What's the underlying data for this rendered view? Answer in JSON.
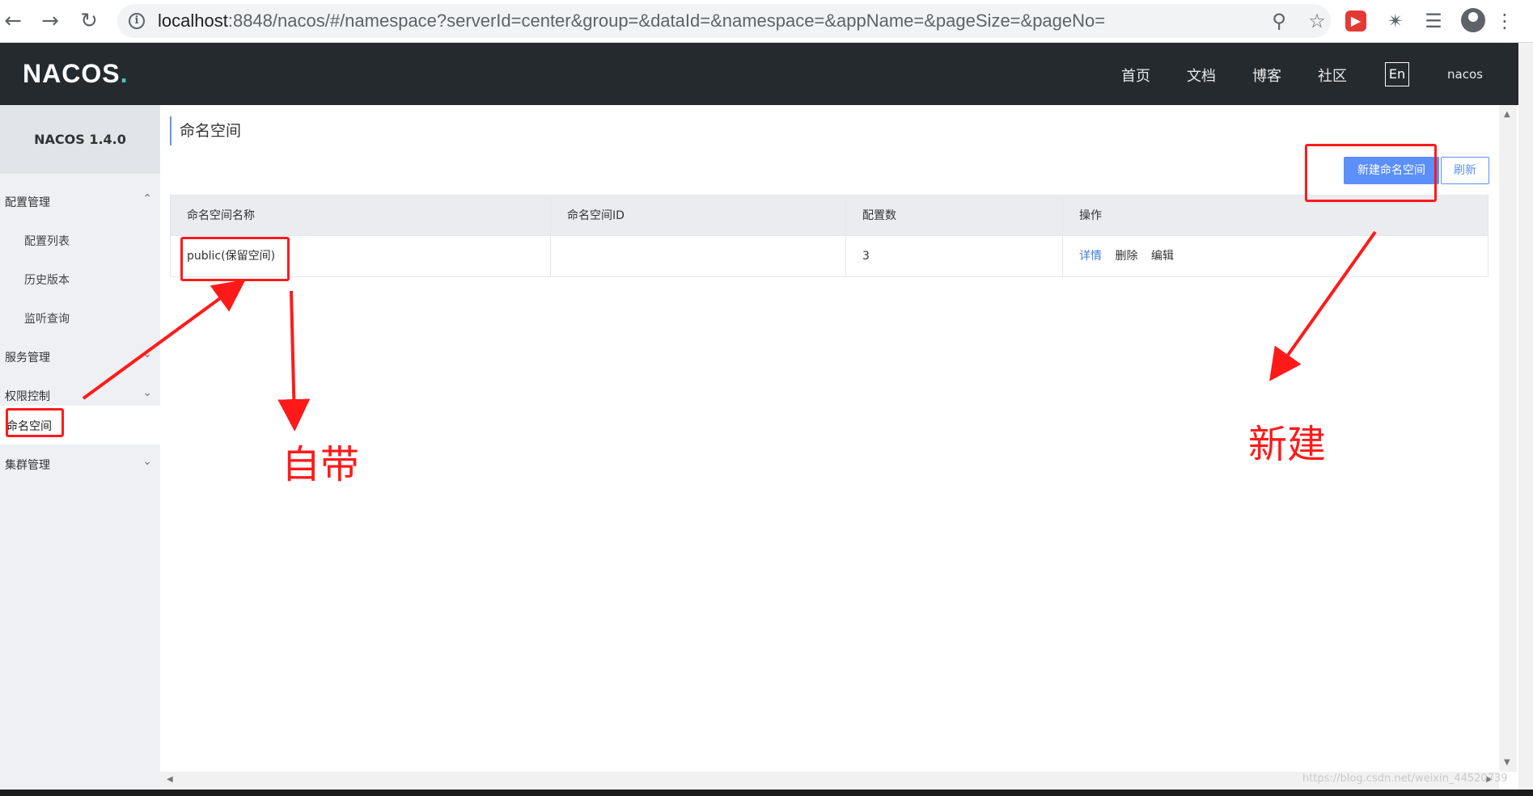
{
  "browser": {
    "url_host": "localhost",
    "url_rest": ":8848/nacos/#/namespace?serverId=center&group=&dataId=&namespace=&appName=&pageSize=&pageNo=",
    "icons": [
      "back-icon",
      "forward-icon",
      "reload-icon",
      "info-icon",
      "zoom-icon",
      "star-icon",
      "extension-red-icon",
      "puzzle-icon",
      "media-icon",
      "profile-icon",
      "menu-dots-icon"
    ]
  },
  "header": {
    "logo": "NACOS",
    "logo_dot": ".",
    "nav": [
      "首页",
      "文档",
      "博客",
      "社区"
    ],
    "lang": "En",
    "user": "nacos"
  },
  "sidebar": {
    "version": "NACOS 1.4.0",
    "groups": [
      {
        "label": "配置管理",
        "chevron": "^"
      },
      {
        "label": "服务管理",
        "chevron": "v"
      },
      {
        "label": "权限控制",
        "chevron": "v"
      },
      {
        "label": "集群管理",
        "chevron": "v"
      }
    ],
    "config_items": [
      "配置列表",
      "历史版本",
      "监听查询"
    ],
    "active": "命名空间"
  },
  "main": {
    "title": "命名空间",
    "new_button": "新建命名空间",
    "refresh_button": "刷新",
    "columns": [
      "命名空间名称",
      "命名空间ID",
      "配置数",
      "操作"
    ],
    "rows": [
      {
        "name": "public(保留空间)",
        "id": "",
        "count": "3",
        "ops": [
          "详情",
          "删除",
          "编辑"
        ]
      }
    ]
  },
  "annotations": {
    "label_builtin": "自带",
    "label_new": "新建",
    "color": "#ff1a1a"
  },
  "watermark": "https://blog.csdn.net/weixin_44520739"
}
